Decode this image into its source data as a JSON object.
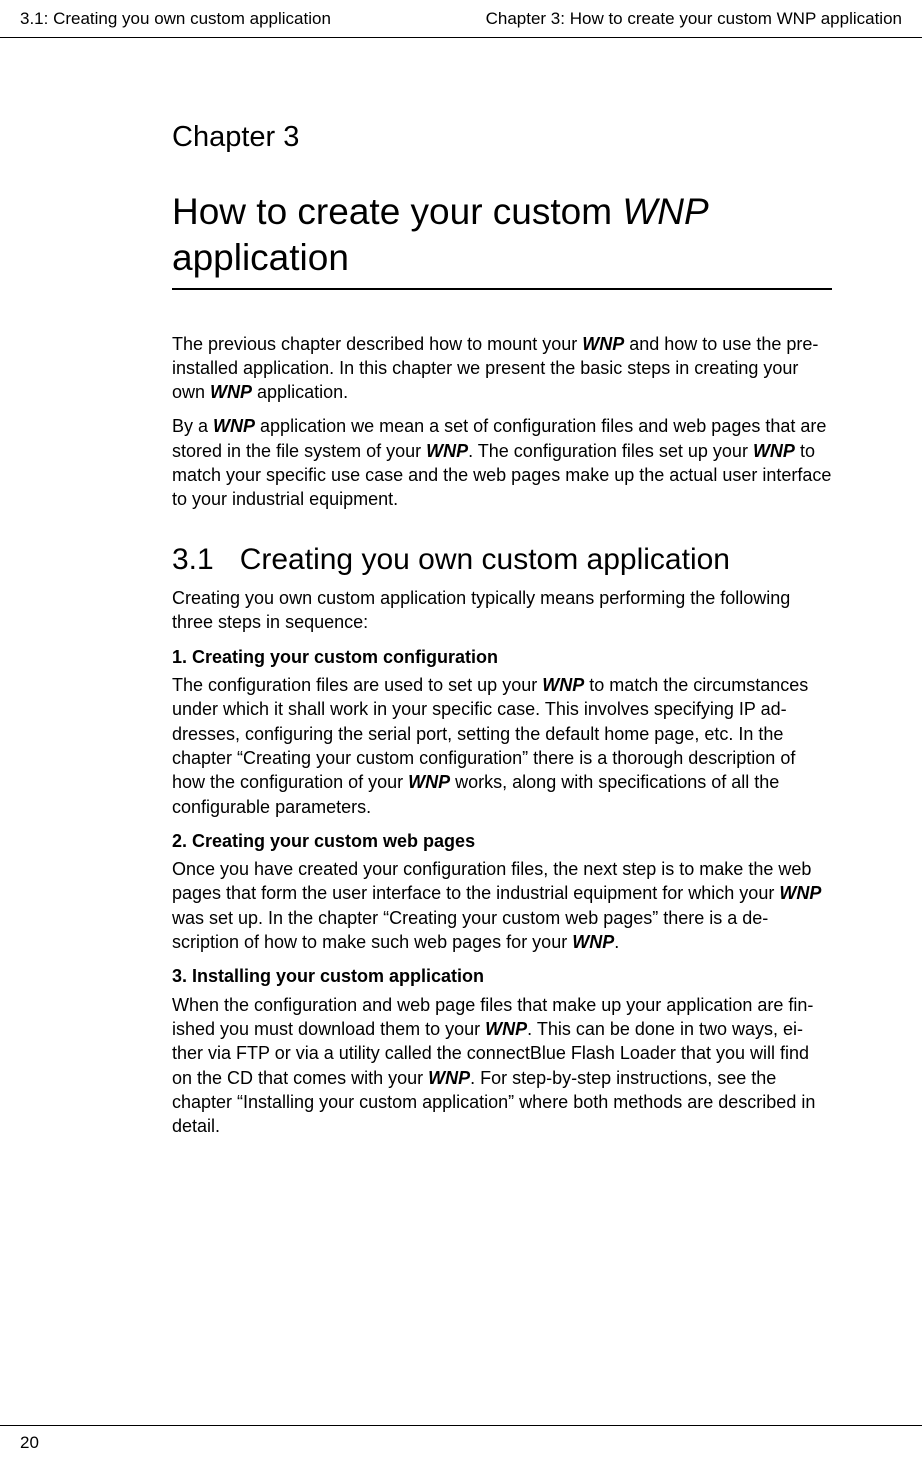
{
  "header": {
    "left": "3.1: Creating you own custom application",
    "right": "Chapter 3: How to create your custom WNP application"
  },
  "chapter": {
    "label": "Chapter 3",
    "title_pre": "How to create your custom ",
    "title_wnp": "WNP",
    "title_post": " application"
  },
  "intro": {
    "p1_a": "The previous chapter described how to mount your ",
    "p1_b": " and how to use the pre-installed application. In this chapter we present the basic steps in creating your own ",
    "p1_c": " application.",
    "p2_a": "By a ",
    "p2_b": " application we mean a set of configuration files and web pages that are stored in the file system of your ",
    "p2_c": ". The configuration files set up your ",
    "p2_d": " to match your specific use case and the web pages make up the actual user interface to your industrial equipment."
  },
  "section": {
    "num": "3.1",
    "title": "Creating you own custom application",
    "lead": "Creating you own custom application typically means performing the following three steps in sequence:"
  },
  "steps": {
    "s1_h": "1. Creating your custom configuration",
    "s1_a": "The configuration files are used to set up your ",
    "s1_b": " to match the circumstances under which it shall work in your specific case. This involves specifying IP ad-dresses, configuring the serial port, setting the default home page, etc. In the chapter “Creating your custom configuration” there is a thorough description of how the configuration of your ",
    "s1_c": " works, along with specifications of all the configurable parameters.",
    "s2_h": "2. Creating your custom web pages",
    "s2_a": "Once you have created your configuration files, the next step is to make the web pages that form the user interface to the industrial equipment for which your ",
    "s2_b": " was set up. In the chapter “Creating your custom web pages” there is a de-scription of how to make such web pages for your ",
    "s2_c": ".",
    "s3_h": "3. Installing your custom application",
    "s3_a": "When the configuration and web page files that make up your application are fin-ished you must download them to your ",
    "s3_b": ". This can be done in two ways, ei-ther via FTP or via a utility called the connectBlue Flash Loader that you will find on the CD that comes with your ",
    "s3_c": ". For step-by-step instructions, see the chapter “Installing your custom application” where both methods are described in detail."
  },
  "wnp": "WNP",
  "footer": {
    "page": "20"
  }
}
